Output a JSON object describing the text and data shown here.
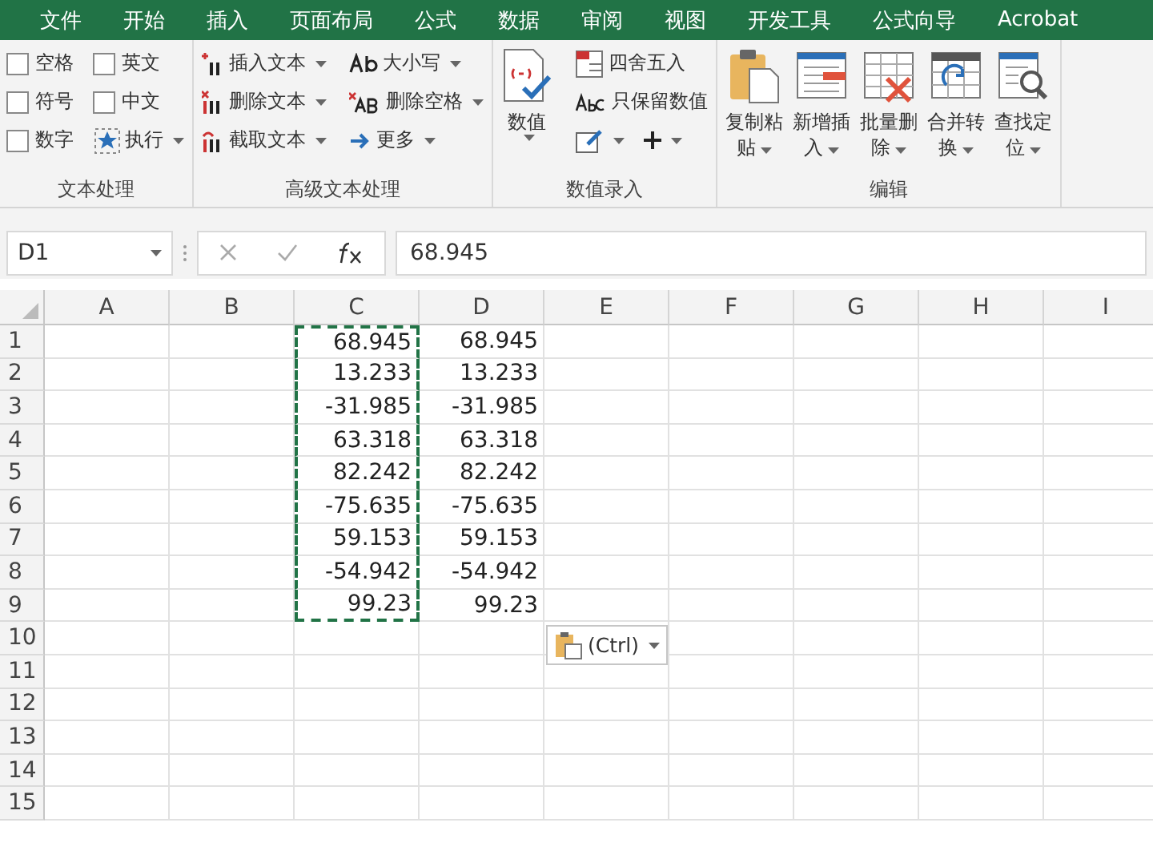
{
  "menu_tabs": [
    "文件",
    "开始",
    "插入",
    "页面布局",
    "公式",
    "数据",
    "审阅",
    "视图",
    "开发工具",
    "公式向导",
    "Acrobat"
  ],
  "ribbon": {
    "groups": [
      {
        "kind": "checks",
        "title": "文本处理",
        "items": [
          {
            "label": "空格",
            "checked": false
          },
          {
            "label": "英文",
            "checked": false
          },
          {
            "label": "符号",
            "checked": false
          },
          {
            "label": "中文",
            "checked": false
          },
          {
            "label": "数字",
            "checked": false
          }
        ],
        "run_button": "执行"
      },
      {
        "kind": "textcmds",
        "title": "高级文本处理",
        "columns": [
          [
            "插入文本",
            "删除文本",
            "截取文本"
          ],
          [
            "大小写",
            "删除空格",
            "更多"
          ]
        ]
      },
      {
        "kind": "numbers",
        "title": "数值录入",
        "big": "数值",
        "small": [
          "四舍五入",
          "只保留数值"
        ]
      },
      {
        "kind": "bigs",
        "title": "编辑",
        "buttons": [
          [
            "复制粘",
            "贴"
          ],
          [
            "新增插",
            "入"
          ],
          [
            "批量删",
            "除"
          ],
          [
            "合并转",
            "换"
          ],
          [
            "查找定",
            "位"
          ]
        ]
      }
    ]
  },
  "formula_bar": {
    "name_box": "D1",
    "value": "68.945"
  },
  "sheet": {
    "columns": [
      {
        "label": "A",
        "copied": false
      },
      {
        "label": "B",
        "copied": false
      },
      {
        "label": "C",
        "copied": true
      },
      {
        "label": "D",
        "copied": false
      },
      {
        "label": "E",
        "copied": false
      },
      {
        "label": "F",
        "copied": false
      },
      {
        "label": "G",
        "copied": false
      },
      {
        "label": "H",
        "copied": false
      },
      {
        "label": "I",
        "copied": false
      }
    ],
    "rows": [
      {
        "label": "1",
        "cells": [
          "",
          "",
          "68.945",
          "68.945",
          "",
          "",
          "",
          "",
          ""
        ]
      },
      {
        "label": "2",
        "cells": [
          "",
          "",
          "13.233",
          "13.233",
          "",
          "",
          "",
          "",
          ""
        ]
      },
      {
        "label": "3",
        "cells": [
          "",
          "",
          "-31.985",
          "-31.985",
          "",
          "",
          "",
          "",
          ""
        ]
      },
      {
        "label": "4",
        "cells": [
          "",
          "",
          "63.318",
          "63.318",
          "",
          "",
          "",
          "",
          ""
        ]
      },
      {
        "label": "5",
        "cells": [
          "",
          "",
          "82.242",
          "82.242",
          "",
          "",
          "",
          "",
          ""
        ]
      },
      {
        "label": "6",
        "cells": [
          "",
          "",
          "-75.635",
          "-75.635",
          "",
          "",
          "",
          "",
          ""
        ]
      },
      {
        "label": "7",
        "cells": [
          "",
          "",
          "59.153",
          "59.153",
          "",
          "",
          "",
          "",
          ""
        ]
      },
      {
        "label": "8",
        "cells": [
          "",
          "",
          "-54.942",
          "-54.942",
          "",
          "",
          "",
          "",
          ""
        ]
      },
      {
        "label": "9",
        "cells": [
          "",
          "",
          "99.23",
          "99.23",
          "",
          "",
          "",
          "",
          ""
        ]
      },
      {
        "label": "10",
        "cells": [
          "",
          "",
          "",
          "",
          "",
          "",
          "",
          "",
          ""
        ]
      },
      {
        "label": "11",
        "cells": [
          "",
          "",
          "",
          "",
          "",
          "",
          "",
          "",
          ""
        ]
      },
      {
        "label": "12",
        "cells": [
          "",
          "",
          "",
          "",
          "",
          "",
          "",
          "",
          ""
        ]
      },
      {
        "label": "13",
        "cells": [
          "",
          "",
          "",
          "",
          "",
          "",
          "",
          "",
          ""
        ]
      },
      {
        "label": "14",
        "cells": [
          "",
          "",
          "",
          "",
          "",
          "",
          "",
          "",
          ""
        ]
      },
      {
        "label": "15",
        "cells": [
          "",
          "",
          "",
          "",
          "",
          "",
          "",
          "",
          ""
        ]
      }
    ]
  },
  "paste_options": {
    "label": "(Ctrl)"
  }
}
